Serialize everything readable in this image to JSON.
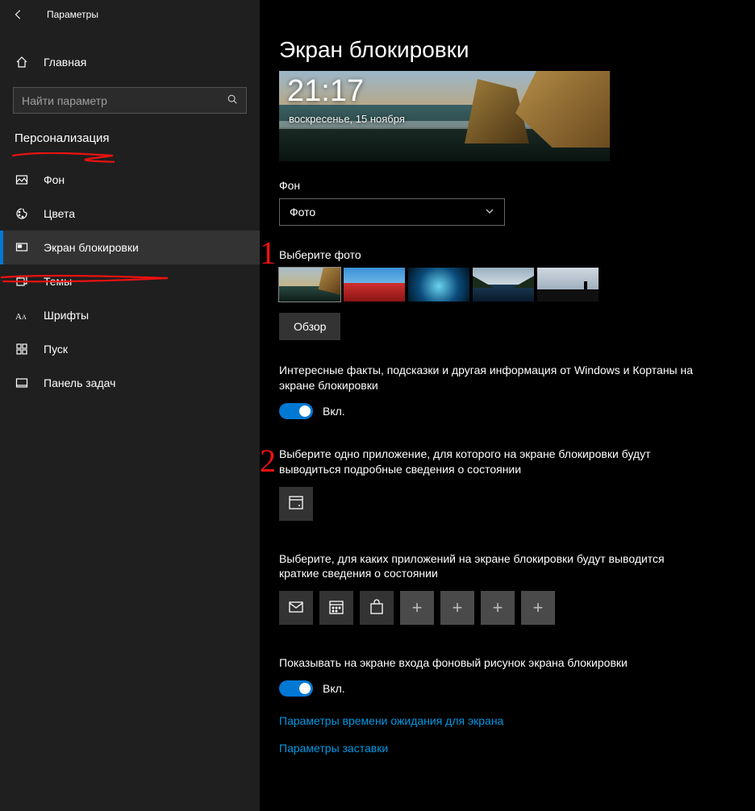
{
  "titlebar": {
    "title": "Параметры"
  },
  "home": {
    "label": "Главная"
  },
  "search": {
    "placeholder": "Найти параметр"
  },
  "section": {
    "title": "Персонализация"
  },
  "nav": {
    "items": [
      {
        "label": "Фон",
        "icon": "picture-icon"
      },
      {
        "label": "Цвета",
        "icon": "palette-icon"
      },
      {
        "label": "Экран блокировки",
        "icon": "lockscreen-icon",
        "active": true
      },
      {
        "label": "Темы",
        "icon": "themes-icon"
      },
      {
        "label": "Шрифты",
        "icon": "fonts-icon"
      },
      {
        "label": "Пуск",
        "icon": "start-icon"
      },
      {
        "label": "Панель задач",
        "icon": "taskbar-icon"
      }
    ]
  },
  "page": {
    "title": "Экран блокировки",
    "preview": {
      "time": "21:17",
      "date": "воскресенье, 15 ноября"
    },
    "background_label": "Фон",
    "background_select": "Фото",
    "choose_photo_label": "Выберите фото",
    "browse_button": "Обзор",
    "facts_text": "Интересные факты, подсказки и другая информация от Windows и Кортаны на экране блокировки",
    "facts_toggle_label": "Вкл.",
    "detailed_app_text": "Выберите одно приложение, для которого на экране блокировки будут выводиться подробные сведения о состоянии",
    "quick_apps_text": "Выберите, для каких приложений на экране блокировки будут выводится краткие сведения о состоянии",
    "show_on_signin_text": "Показывать на экране входа фоновый рисунок экрана блокировки",
    "signin_toggle_label": "Вкл.",
    "link_timeout": "Параметры времени ожидания для экрана",
    "link_screensaver": "Параметры заставки"
  },
  "annotations": {
    "one": "1",
    "two": "2"
  }
}
